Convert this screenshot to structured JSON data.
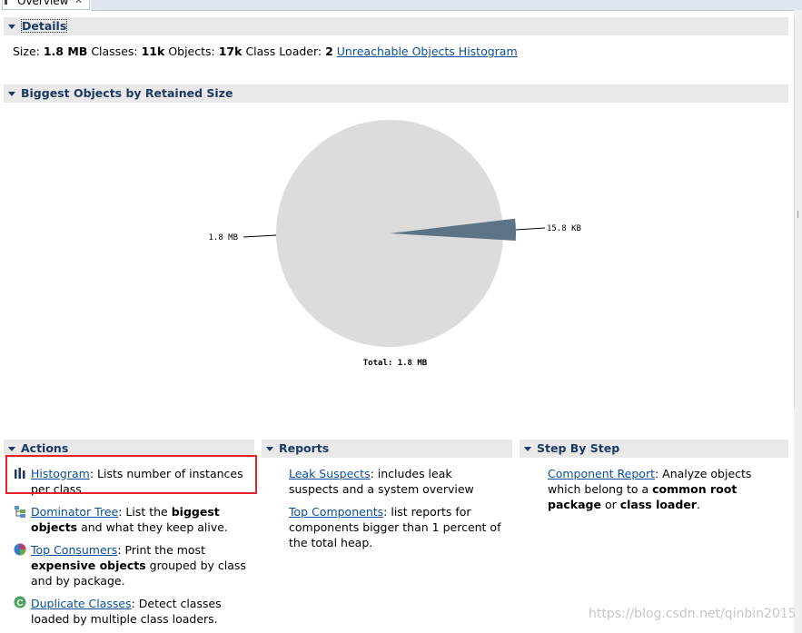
{
  "tab": {
    "label": "Overview",
    "close": "✕"
  },
  "details": {
    "header": "Details",
    "size_label": "Size:",
    "size_value": "1.8 MB",
    "classes_label": "Classes:",
    "classes_value": "11k",
    "objects_label": "Objects:",
    "objects_value": "17k",
    "loader_label": "Class Loader:",
    "loader_value": "2",
    "histogram_link": "Unreachable Objects Histogram"
  },
  "biggest": {
    "header": "Biggest Objects by Retained Size"
  },
  "chart_data": {
    "type": "pie",
    "slices": [
      {
        "label": "1.8 MB",
        "value": 1800,
        "unit": "KB",
        "color": "#dcdcdc"
      },
      {
        "label": "15.8 KB",
        "value": 15.8,
        "unit": "KB",
        "color": "#5b7486"
      }
    ],
    "total_label": "Total: 1.8 MB"
  },
  "actions": {
    "header": "Actions",
    "items": [
      {
        "link": "Histogram",
        "text": ": Lists number of instances per class"
      },
      {
        "link": "Dominator Tree",
        "pre": ": List the ",
        "bold": "biggest objects",
        "post": " and what they keep alive."
      },
      {
        "link": "Top Consumers",
        "pre": ": Print the most ",
        "bold": "expensive objects",
        "post": " grouped by class and by package."
      },
      {
        "link": "Duplicate Classes",
        "text": ": Detect classes loaded by multiple class loaders."
      }
    ]
  },
  "reports": {
    "header": "Reports",
    "items": [
      {
        "link": "Leak Suspects",
        "text": ": includes leak suspects and a system overview"
      },
      {
        "link": "Top Components",
        "text": ": list reports for components bigger than 1 percent of the total heap."
      }
    ]
  },
  "stepbystep": {
    "header": "Step By Step",
    "items": [
      {
        "link": "Component Report",
        "pre": ": Analyze objects which belong to a ",
        "bold1": "common root package",
        "mid": " or ",
        "bold2": "class loader",
        "post": "."
      }
    ]
  },
  "watermark": "https://blog.csdn.net/qinbin2015",
  "colors": {
    "header_text": "#1d3a63",
    "header_bg": "#e9e9e9",
    "link": "#0b4d9b",
    "highlight": "#e8232b"
  }
}
